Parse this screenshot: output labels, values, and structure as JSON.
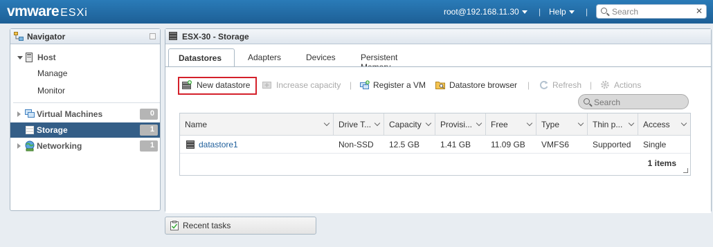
{
  "topbar": {
    "brand_bold": "vmware",
    "brand_product": "ESXi",
    "user": "root@192.168.11.30",
    "help": "Help",
    "search_placeholder": "Search",
    "separator": "|"
  },
  "navigator": {
    "title": "Navigator",
    "host_label": "Host",
    "manage_label": "Manage",
    "monitor_label": "Monitor",
    "items": [
      {
        "label": "Virtual Machines",
        "count": "0"
      },
      {
        "label": "Storage",
        "count": "1"
      },
      {
        "label": "Networking",
        "count": "1"
      }
    ]
  },
  "main": {
    "title": "ESX-30 - Storage",
    "tabs": [
      {
        "label": "Datastores"
      },
      {
        "label": "Adapters"
      },
      {
        "label": "Devices"
      },
      {
        "label": "Persistent Memory"
      }
    ],
    "toolbar": {
      "new_datastore": "New datastore",
      "increase_capacity": "Increase capacity",
      "register_vm": "Register a VM",
      "datastore_browser": "Datastore browser",
      "refresh": "Refresh",
      "actions": "Actions",
      "sep": "|"
    },
    "search_placeholder": "Search",
    "table": {
      "columns": [
        "Name",
        "Drive T...",
        "Capacity",
        "Provisi...",
        "Free",
        "Type",
        "Thin p...",
        "Access"
      ],
      "rows": [
        [
          "datastore1",
          "Non-SSD",
          "12.5 GB",
          "1.41 GB",
          "11.09 GB",
          "VMFS6",
          "Supported",
          "Single"
        ]
      ],
      "footer": "1 items"
    }
  },
  "recent_tasks": {
    "label": "Recent tasks"
  },
  "colors": {
    "topbar": "#1d5f96",
    "selected_nav": "#345e87",
    "highlight_box": "#d4202a",
    "link": "#1f5f9b"
  }
}
